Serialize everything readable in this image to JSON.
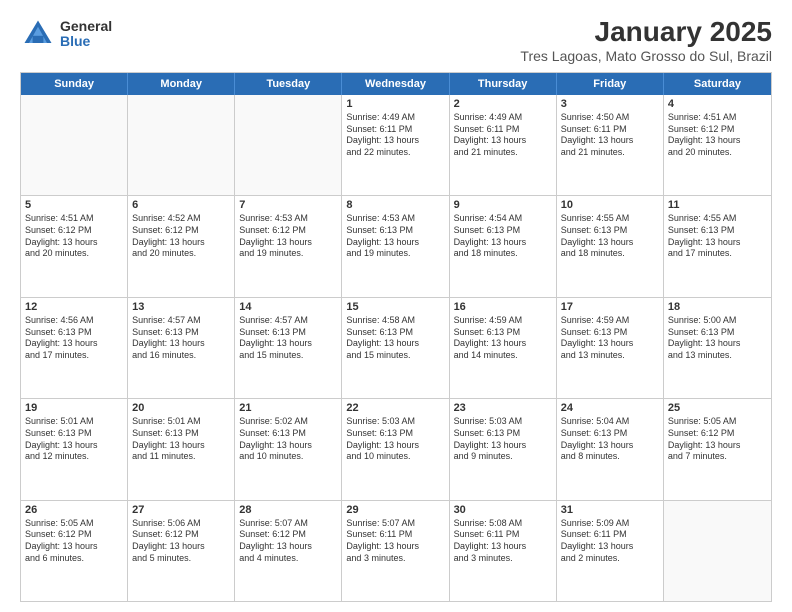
{
  "logo": {
    "general": "General",
    "blue": "Blue"
  },
  "title": {
    "month": "January 2025",
    "location": "Tres Lagoas, Mato Grosso do Sul, Brazil"
  },
  "header_days": [
    "Sunday",
    "Monday",
    "Tuesday",
    "Wednesday",
    "Thursday",
    "Friday",
    "Saturday"
  ],
  "weeks": [
    [
      {
        "day": "",
        "text": "",
        "empty": true
      },
      {
        "day": "",
        "text": "",
        "empty": true
      },
      {
        "day": "",
        "text": "",
        "empty": true
      },
      {
        "day": "1",
        "text": "Sunrise: 4:49 AM\nSunset: 6:11 PM\nDaylight: 13 hours\nand 22 minutes.",
        "empty": false
      },
      {
        "day": "2",
        "text": "Sunrise: 4:49 AM\nSunset: 6:11 PM\nDaylight: 13 hours\nand 21 minutes.",
        "empty": false
      },
      {
        "day": "3",
        "text": "Sunrise: 4:50 AM\nSunset: 6:11 PM\nDaylight: 13 hours\nand 21 minutes.",
        "empty": false
      },
      {
        "day": "4",
        "text": "Sunrise: 4:51 AM\nSunset: 6:12 PM\nDaylight: 13 hours\nand 20 minutes.",
        "empty": false
      }
    ],
    [
      {
        "day": "5",
        "text": "Sunrise: 4:51 AM\nSunset: 6:12 PM\nDaylight: 13 hours\nand 20 minutes.",
        "empty": false
      },
      {
        "day": "6",
        "text": "Sunrise: 4:52 AM\nSunset: 6:12 PM\nDaylight: 13 hours\nand 20 minutes.",
        "empty": false
      },
      {
        "day": "7",
        "text": "Sunrise: 4:53 AM\nSunset: 6:12 PM\nDaylight: 13 hours\nand 19 minutes.",
        "empty": false
      },
      {
        "day": "8",
        "text": "Sunrise: 4:53 AM\nSunset: 6:13 PM\nDaylight: 13 hours\nand 19 minutes.",
        "empty": false
      },
      {
        "day": "9",
        "text": "Sunrise: 4:54 AM\nSunset: 6:13 PM\nDaylight: 13 hours\nand 18 minutes.",
        "empty": false
      },
      {
        "day": "10",
        "text": "Sunrise: 4:55 AM\nSunset: 6:13 PM\nDaylight: 13 hours\nand 18 minutes.",
        "empty": false
      },
      {
        "day": "11",
        "text": "Sunrise: 4:55 AM\nSunset: 6:13 PM\nDaylight: 13 hours\nand 17 minutes.",
        "empty": false
      }
    ],
    [
      {
        "day": "12",
        "text": "Sunrise: 4:56 AM\nSunset: 6:13 PM\nDaylight: 13 hours\nand 17 minutes.",
        "empty": false
      },
      {
        "day": "13",
        "text": "Sunrise: 4:57 AM\nSunset: 6:13 PM\nDaylight: 13 hours\nand 16 minutes.",
        "empty": false
      },
      {
        "day": "14",
        "text": "Sunrise: 4:57 AM\nSunset: 6:13 PM\nDaylight: 13 hours\nand 15 minutes.",
        "empty": false
      },
      {
        "day": "15",
        "text": "Sunrise: 4:58 AM\nSunset: 6:13 PM\nDaylight: 13 hours\nand 15 minutes.",
        "empty": false
      },
      {
        "day": "16",
        "text": "Sunrise: 4:59 AM\nSunset: 6:13 PM\nDaylight: 13 hours\nand 14 minutes.",
        "empty": false
      },
      {
        "day": "17",
        "text": "Sunrise: 4:59 AM\nSunset: 6:13 PM\nDaylight: 13 hours\nand 13 minutes.",
        "empty": false
      },
      {
        "day": "18",
        "text": "Sunrise: 5:00 AM\nSunset: 6:13 PM\nDaylight: 13 hours\nand 13 minutes.",
        "empty": false
      }
    ],
    [
      {
        "day": "19",
        "text": "Sunrise: 5:01 AM\nSunset: 6:13 PM\nDaylight: 13 hours\nand 12 minutes.",
        "empty": false
      },
      {
        "day": "20",
        "text": "Sunrise: 5:01 AM\nSunset: 6:13 PM\nDaylight: 13 hours\nand 11 minutes.",
        "empty": false
      },
      {
        "day": "21",
        "text": "Sunrise: 5:02 AM\nSunset: 6:13 PM\nDaylight: 13 hours\nand 10 minutes.",
        "empty": false
      },
      {
        "day": "22",
        "text": "Sunrise: 5:03 AM\nSunset: 6:13 PM\nDaylight: 13 hours\nand 10 minutes.",
        "empty": false
      },
      {
        "day": "23",
        "text": "Sunrise: 5:03 AM\nSunset: 6:13 PM\nDaylight: 13 hours\nand 9 minutes.",
        "empty": false
      },
      {
        "day": "24",
        "text": "Sunrise: 5:04 AM\nSunset: 6:13 PM\nDaylight: 13 hours\nand 8 minutes.",
        "empty": false
      },
      {
        "day": "25",
        "text": "Sunrise: 5:05 AM\nSunset: 6:12 PM\nDaylight: 13 hours\nand 7 minutes.",
        "empty": false
      }
    ],
    [
      {
        "day": "26",
        "text": "Sunrise: 5:05 AM\nSunset: 6:12 PM\nDaylight: 13 hours\nand 6 minutes.",
        "empty": false
      },
      {
        "day": "27",
        "text": "Sunrise: 5:06 AM\nSunset: 6:12 PM\nDaylight: 13 hours\nand 5 minutes.",
        "empty": false
      },
      {
        "day": "28",
        "text": "Sunrise: 5:07 AM\nSunset: 6:12 PM\nDaylight: 13 hours\nand 4 minutes.",
        "empty": false
      },
      {
        "day": "29",
        "text": "Sunrise: 5:07 AM\nSunset: 6:11 PM\nDaylight: 13 hours\nand 3 minutes.",
        "empty": false
      },
      {
        "day": "30",
        "text": "Sunrise: 5:08 AM\nSunset: 6:11 PM\nDaylight: 13 hours\nand 3 minutes.",
        "empty": false
      },
      {
        "day": "31",
        "text": "Sunrise: 5:09 AM\nSunset: 6:11 PM\nDaylight: 13 hours\nand 2 minutes.",
        "empty": false
      },
      {
        "day": "",
        "text": "",
        "empty": true
      }
    ]
  ]
}
